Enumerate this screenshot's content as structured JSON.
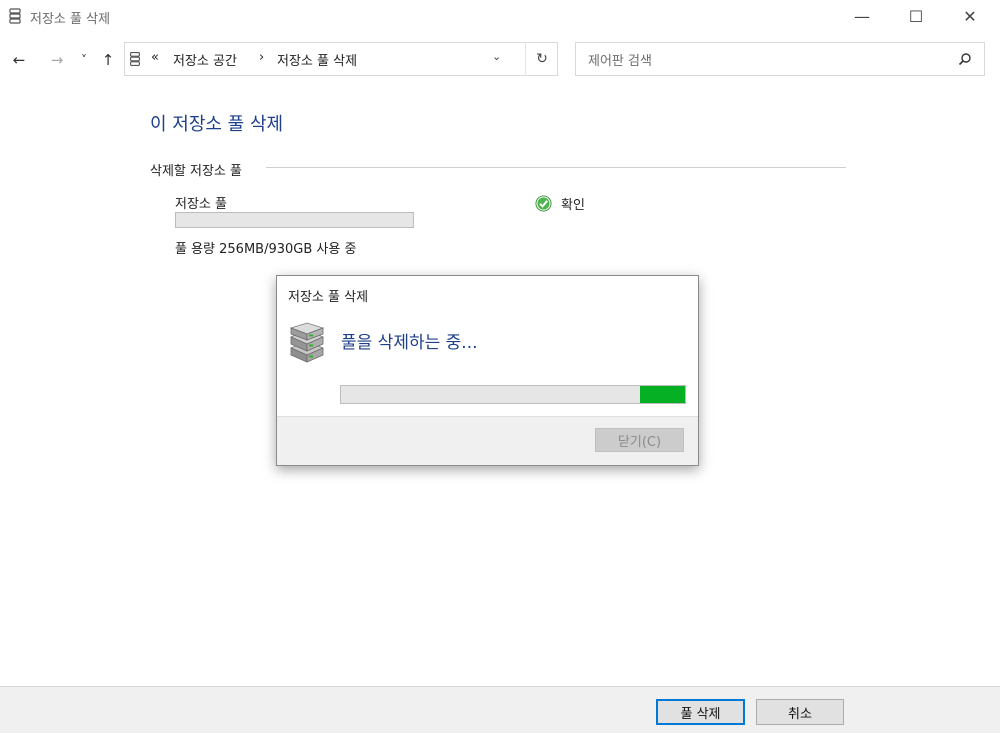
{
  "window": {
    "title": "저장소 풀 삭제",
    "minimize_glyph": "—",
    "maximize_glyph": "☐",
    "close_glyph": "✕"
  },
  "nav": {
    "back_glyph": "←",
    "forward_glyph": "→",
    "recent_glyph": "˅",
    "up_glyph": "↑",
    "breadcrumb_overflow": "«",
    "breadcrumb": [
      "저장소 공간",
      "저장소 풀 삭제"
    ],
    "breadcrumb_separator": "›",
    "dropdown_glyph": "⌄",
    "refresh_glyph": "↻"
  },
  "search": {
    "placeholder": "제어판 검색"
  },
  "main": {
    "page_title": "이 저장소 풀 삭제",
    "group_label": "삭제할 저장소 풀",
    "pool_name": "저장소 풀",
    "pool_capacity": "풀 용량 256MB/930GB 사용 중",
    "status_text": "확인"
  },
  "dialog": {
    "title": "저장소 풀 삭제",
    "heading": "풀을 삭제하는 중...",
    "progress_segment": {
      "start": 0.87,
      "end": 1.0
    },
    "close_label": "닫기(C)"
  },
  "footer": {
    "delete_pool_label": "풀 삭제",
    "cancel_label": "취소"
  },
  "colors": {
    "accent_blue": "#1e3f8a",
    "progress_green": "#06b025",
    "focus_border": "#0078d7"
  },
  "icons": {
    "title": "storage-pool-icon",
    "address": "storage-pool-icon",
    "search": "search-icon",
    "status": "check-circle-icon",
    "dialog": "hard-drives-icon"
  }
}
